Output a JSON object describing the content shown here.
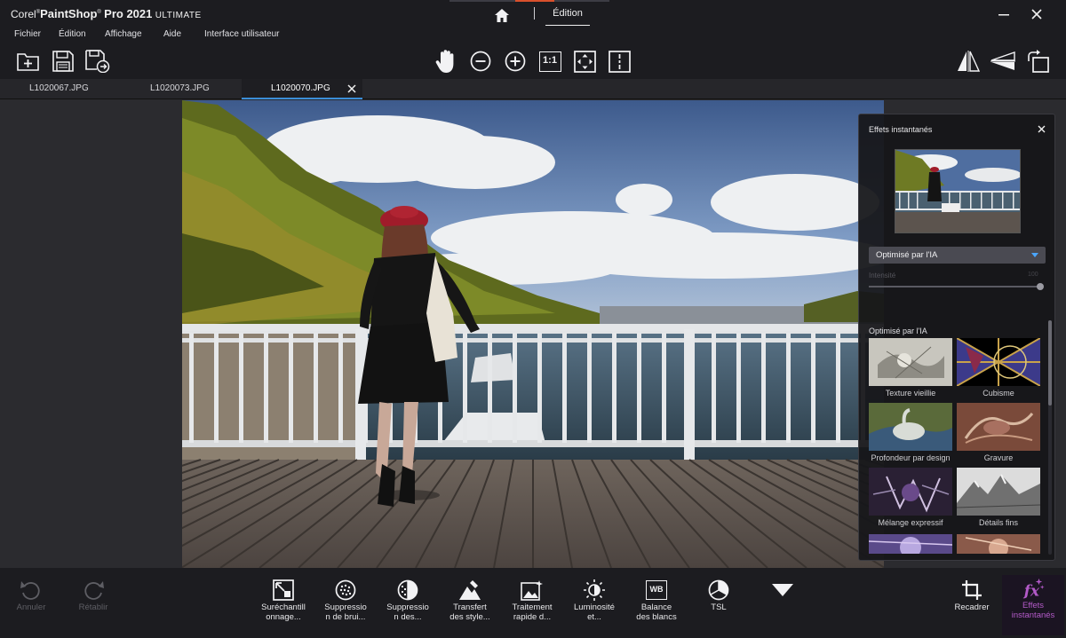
{
  "app": {
    "title_prefix": "Corel",
    "title_brand": "PaintShop",
    "title_suffix": "Pro 2021",
    "edition_badge": "ULTIMATE"
  },
  "mode_tabs": {
    "home_icon": "home-icon",
    "edit_label": "Édition"
  },
  "menu": {
    "items": [
      "Fichier",
      "Édition",
      "Affichage",
      "Aide",
      "Interface utilisateur"
    ]
  },
  "toolbar": {
    "left_icons": [
      "new-file-icon",
      "save-icon",
      "save-as-icon"
    ],
    "center_icons": [
      "pan-hand-icon",
      "zoom-out-icon",
      "zoom-in-icon",
      "actual-size-icon",
      "fit-window-icon",
      "compare-icon"
    ],
    "actual_size_label": "1:1",
    "right_icons": [
      "flip-horizontal-icon",
      "flip-vertical-icon",
      "rotate-icon"
    ]
  },
  "tabs": [
    {
      "label": "L1020067.JPG",
      "active": false
    },
    {
      "label": "L1020073.JPG",
      "active": false
    },
    {
      "label": "L1020070.JPG",
      "active": true
    }
  ],
  "fx_panel": {
    "title": "Effets instantanés",
    "selected_category": "Optimisé par l'IA",
    "intensity_label": "Intensité",
    "intensity_value": "100",
    "intensity": 1.0,
    "category_label": "Optimisé par l'IA",
    "effects": [
      {
        "label": "Texture vieillie"
      },
      {
        "label": "Cubisme"
      },
      {
        "label": "Profondeur par design"
      },
      {
        "label": "Gravure"
      },
      {
        "label": "Mélange expressif"
      },
      {
        "label": "Détails fins"
      }
    ]
  },
  "bottom": {
    "undo": "Annuler",
    "redo": "Rétablir",
    "tools": [
      {
        "label": "Suréchantill\nonnage...",
        "icon": "upsample-icon"
      },
      {
        "label": "Suppressio\nn de brui...",
        "icon": "noise-removal-icon"
      },
      {
        "label": "Suppressio\nn des...",
        "icon": "artifact-removal-icon"
      },
      {
        "label": "Transfert\ndes style...",
        "icon": "style-transfer-icon"
      },
      {
        "label": "Traitement\nrapide d...",
        "icon": "smart-photo-fix-icon"
      },
      {
        "label": "Luminosité\net...",
        "icon": "brightness-icon"
      },
      {
        "label": "Balance\ndes blancs",
        "icon": "white-balance-icon"
      },
      {
        "label": "TSL",
        "icon": "hsl-icon"
      }
    ],
    "wb_glyph": "WB",
    "more_icon": "more-arrow-icon",
    "crop": "Recadrer",
    "effects": "Effets\ninstantanés"
  },
  "colors": {
    "accent_blue": "#3b8ed8",
    "accent_orange": "#d9502c",
    "accent_purple": "#b35ac8",
    "chrome_bg": "#1c1c20"
  }
}
